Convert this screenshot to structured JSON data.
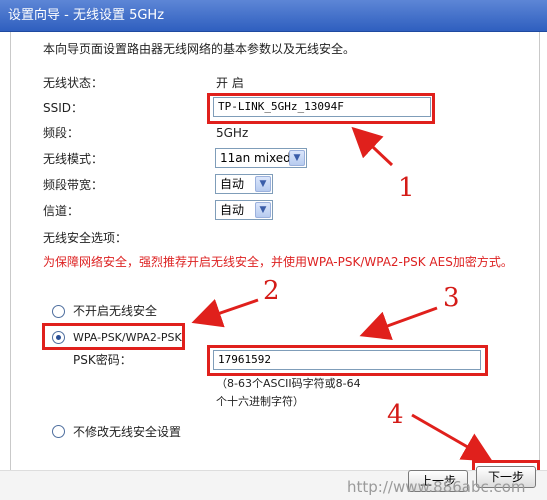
{
  "window": {
    "title": "设置向导 - 无线设置 5GHz"
  },
  "intro": "本向导页面设置路由器无线网络的基本参数以及无线安全。",
  "fields": {
    "status": {
      "label": "无线状态：",
      "value": "开 启"
    },
    "ssid": {
      "label": "SSID：",
      "value": "TP-LINK_5GHz_13094F"
    },
    "band": {
      "label": "频段：",
      "value": "5GHz"
    },
    "mode": {
      "label": "无线模式：",
      "value": "11an mixed"
    },
    "bandwidth": {
      "label": "频段带宽：",
      "value": "自动"
    },
    "channel": {
      "label": "信道：",
      "value": "自动"
    }
  },
  "security": {
    "section_label": "无线安全选项：",
    "warning": "为保障网络安全，强烈推荐开启无线安全，并使用WPA-PSK/WPA2-PSK AES加密方式。",
    "options": [
      {
        "label": "不开启无线安全",
        "checked": false
      },
      {
        "label": "WPA-PSK/WPA2-PSK",
        "checked": true
      },
      {
        "label": "不修改无线安全设置",
        "checked": false
      }
    ],
    "psk_label": "PSK密码：",
    "psk_value": "17961592",
    "psk_hint_1": "（8-63个ASCII码字符或8-64",
    "psk_hint_2": "个十六进制字符）"
  },
  "buttons": {
    "prev": "上一步",
    "next": "下一步"
  },
  "annotations": [
    "1",
    "2",
    "3",
    "4"
  ],
  "watermark": "http://www.886abc.com",
  "colors": {
    "annotation": "#e0201c",
    "title_bar": "#3a67c8"
  }
}
